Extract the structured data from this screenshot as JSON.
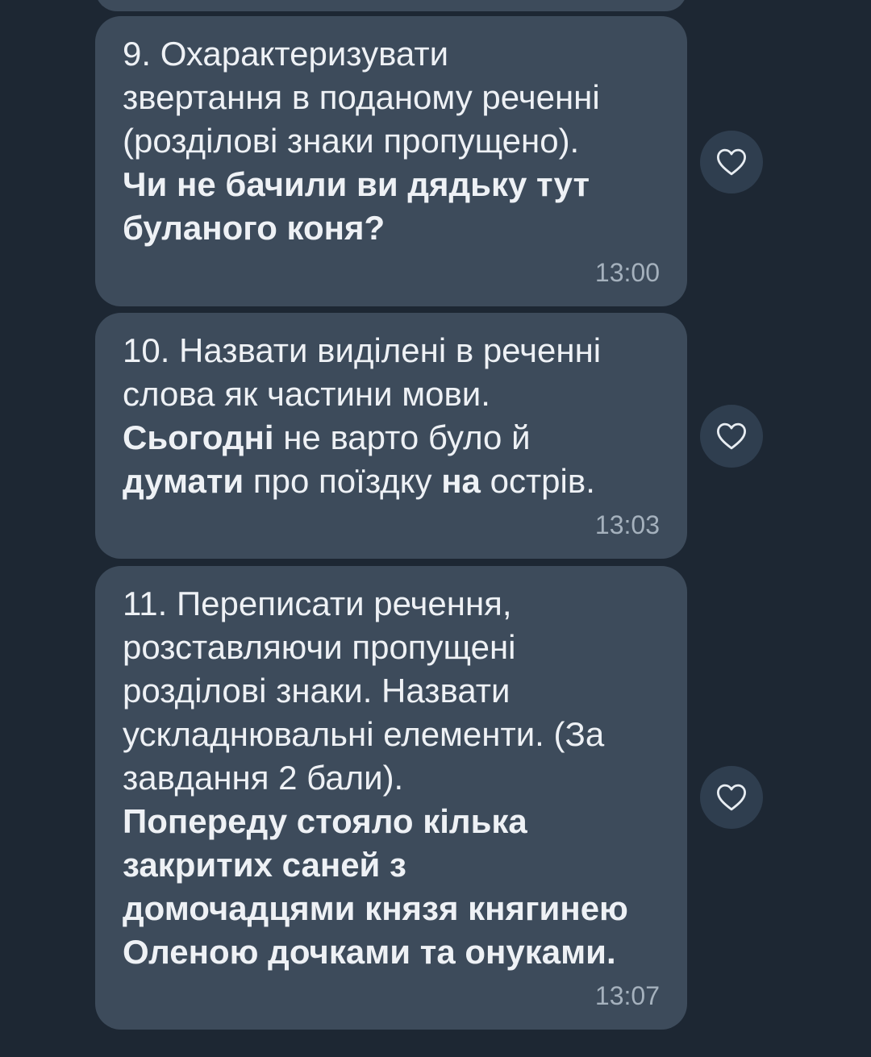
{
  "messages": [
    {
      "lines": [
        [
          {
            "t": "9. Охарактеризувати",
            "b": false
          }
        ],
        [
          {
            "t": "звертання в поданому реченні",
            "b": false
          }
        ],
        [
          {
            "t": "(розділові знаки пропущено).",
            "b": false
          }
        ],
        [
          {
            "t": "Чи не бачили ви дядьку тут",
            "b": true
          }
        ],
        [
          {
            "t": "буланого коня?",
            "b": true
          }
        ]
      ],
      "time": "13:00"
    },
    {
      "lines": [
        [
          {
            "t": "10. Назвати виділені в реченні",
            "b": false
          }
        ],
        [
          {
            "t": "слова як частини мови.",
            "b": false
          }
        ],
        [
          {
            "t": "Сьогодні",
            "b": true
          },
          {
            "t": " не варто було й",
            "b": false
          }
        ],
        [
          {
            "t": "думати",
            "b": true
          },
          {
            "t": " про поїздку ",
            "b": false
          },
          {
            "t": "на",
            "b": true
          },
          {
            "t": " острів.",
            "b": false
          }
        ]
      ],
      "time": "13:03"
    },
    {
      "lines": [
        [
          {
            "t": "11. Переписати речення,",
            "b": false
          }
        ],
        [
          {
            "t": "розставляючи пропущені",
            "b": false
          }
        ],
        [
          {
            "t": "розділові знаки. Назвати",
            "b": false
          }
        ],
        [
          {
            "t": "ускладнювальні елементи. (За",
            "b": false
          }
        ],
        [
          {
            "t": "завдання 2 бали).",
            "b": false
          }
        ],
        [
          {
            "t": "Попереду стояло кілька",
            "b": true
          }
        ],
        [
          {
            "t": "закритих саней з",
            "b": true
          }
        ],
        [
          {
            "t": "домочадцями князя княгинею",
            "b": true
          }
        ],
        [
          {
            "t": "Оленою дочками та онуками.",
            "b": true
          }
        ]
      ],
      "time": "13:07"
    }
  ],
  "icons": {
    "reaction": "heart-outline-icon"
  },
  "colors": {
    "background": "#1d2733",
    "bubble": "#3d4b5b",
    "text": "#eef1f5",
    "time": "#a5b1bd",
    "reaction_button": "#2f3e4f"
  }
}
